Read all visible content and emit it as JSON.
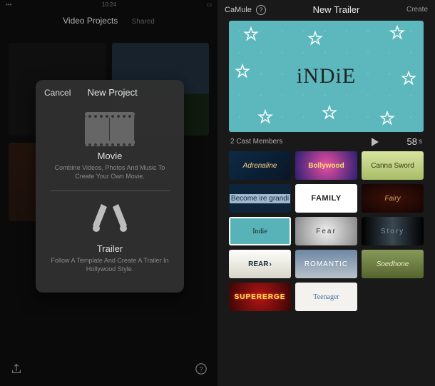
{
  "left": {
    "status": {
      "time": "10:24"
    },
    "header": {
      "title": "Video Projects",
      "secondary": "Shared"
    },
    "modal": {
      "cancel": "Cancel",
      "title": "New Project",
      "movie": {
        "label": "Movie",
        "desc": "Combine Videos, Photos And Music To Create Your Own Movie."
      },
      "trailer": {
        "label": "Trailer",
        "desc": "Follow A Template And Create A Trailer In Hollywood Style."
      }
    }
  },
  "right": {
    "back": "CaMule",
    "title": "New Trailer",
    "create": "Create",
    "preview_title": "iNDiE",
    "cast": "2 Cast Members",
    "duration_num": "58",
    "duration_unit": "s",
    "templates": [
      "Adrenaline",
      "Bollywood",
      "Canna Sword",
      "Become ire grandi",
      "FAMILY",
      "Fairy",
      "Indie",
      "Fear",
      "Story",
      "REAR",
      "ROMANTIC",
      "Soedhone",
      "SUPERERGE",
      "Teenager"
    ],
    "selected_index": 6
  }
}
